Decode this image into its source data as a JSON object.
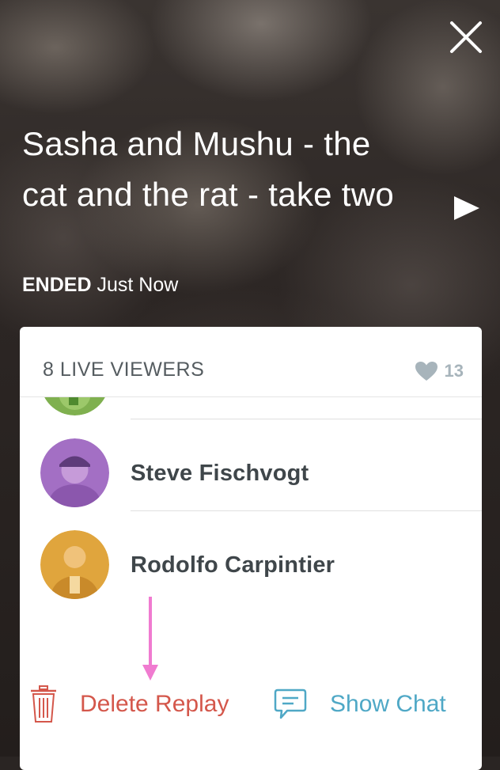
{
  "broadcast": {
    "title": "Sasha and Mushu - the cat and the rat - take two",
    "status_label": "ENDED",
    "status_time": "Just Now"
  },
  "panel": {
    "viewers_label": "8 LIVE VIEWERS",
    "hearts_count": "13",
    "viewers": [
      {
        "name": "",
        "avatar_color": "#7fb04f"
      },
      {
        "name": "Steve Fischvogt",
        "avatar_color": "#a36fc4"
      },
      {
        "name": "Rodolfo Carpintier",
        "avatar_color": "#e0a53d"
      }
    ]
  },
  "actions": {
    "delete_label": "Delete Replay",
    "chat_label": "Show Chat"
  },
  "icons": {
    "close": "close-icon",
    "play": "play-icon",
    "heart": "heart-icon",
    "trash": "trash-icon",
    "chat": "chat-bubble-icon",
    "annotation": "arrow-annotation"
  },
  "colors": {
    "delete": "#d4574b",
    "chat": "#4fa8c6",
    "arrow": "#f07bd0"
  }
}
